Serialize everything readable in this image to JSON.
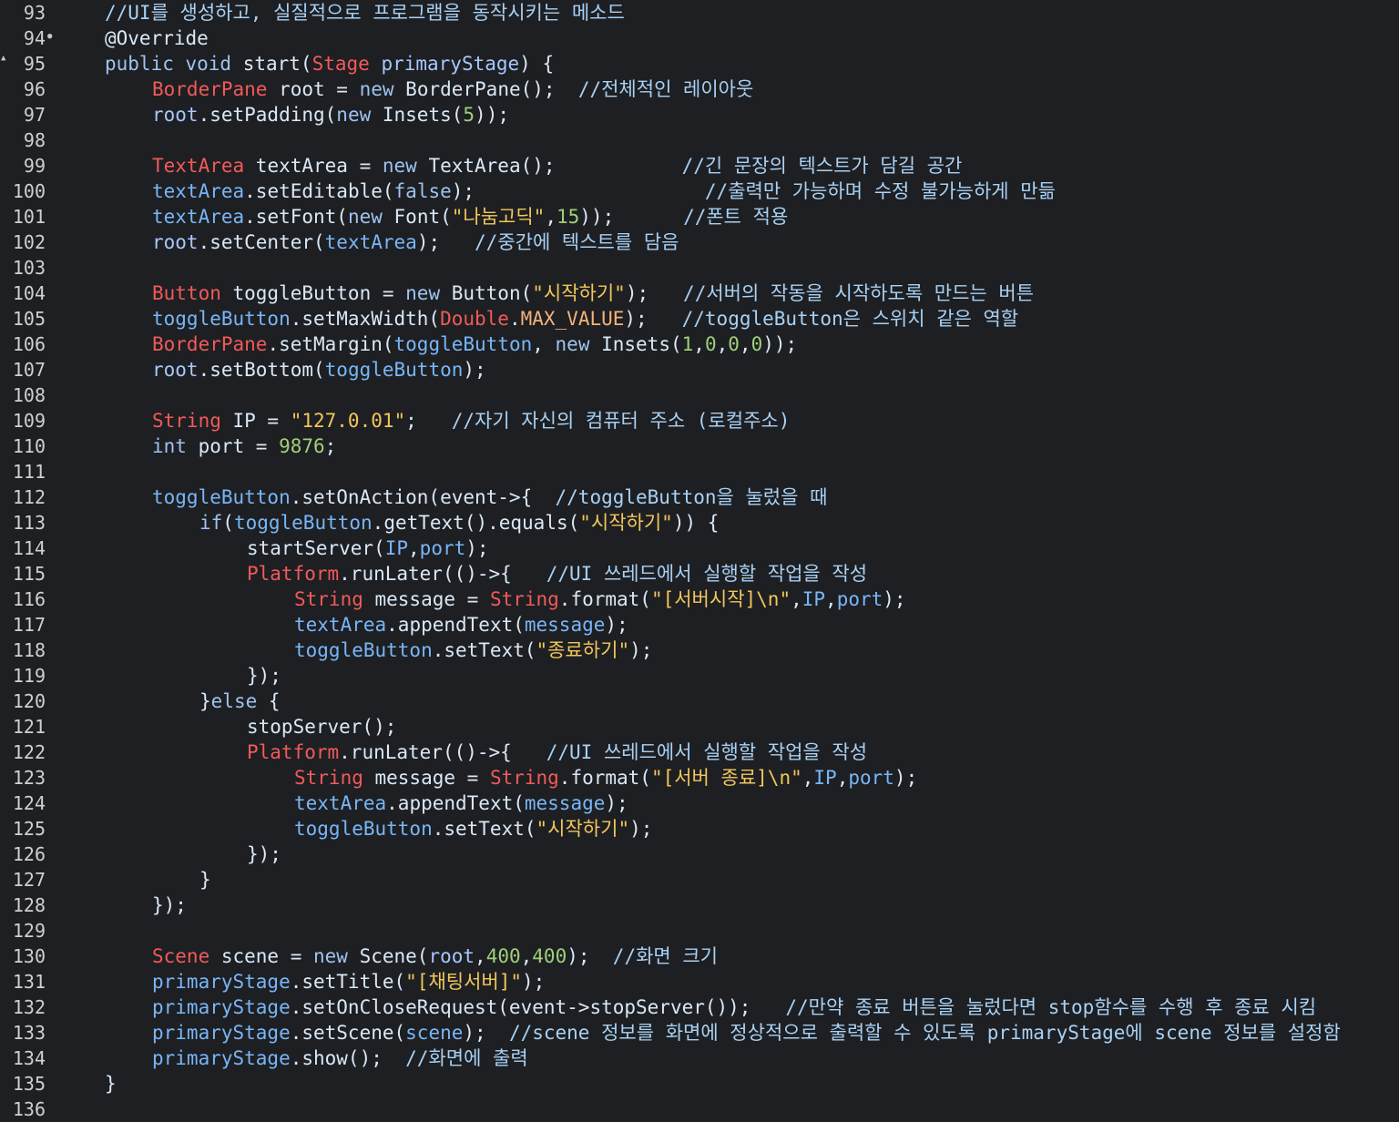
{
  "colors": {
    "background": "#1e1f22",
    "default_text": "#d9e8f7",
    "comment": "#a8d1f5",
    "keyword": "#9ec3f0",
    "type": "#f05a5a",
    "variable": "#a7c7ff",
    "field": "#78b6f8",
    "string": "#f1c75b",
    "number": "#9fd07a",
    "constant": "#f3b27a",
    "line_number": "#d0d0d0"
  },
  "editor": {
    "lines": [
      {
        "num": "93",
        "marker": "",
        "indent": 0,
        "tokens": [
          {
            "t": "//UI를 생성하고, 실질적으로 프로그램을 동작시키는 메소드",
            "k": "comment"
          }
        ]
      },
      {
        "num": "94",
        "marker": "●",
        "indent": 0,
        "tokens": [
          {
            "t": "@Override",
            "k": "annotation"
          }
        ]
      },
      {
        "num": "95",
        "marker": "▲",
        "indent": 0,
        "tokens": [
          {
            "t": "public void ",
            "k": "keyword"
          },
          {
            "t": "start(",
            "k": "default"
          },
          {
            "t": "Stage",
            "k": "type"
          },
          {
            "t": " primaryStage",
            "k": "var"
          },
          {
            "t": ") {",
            "k": "default"
          }
        ]
      },
      {
        "num": "96",
        "marker": "",
        "indent": 1,
        "tokens": [
          {
            "t": "BorderPane",
            "k": "type"
          },
          {
            "t": " root = ",
            "k": "default"
          },
          {
            "t": "new ",
            "k": "keyword"
          },
          {
            "t": "BorderPane();  ",
            "k": "default"
          },
          {
            "t": "//전체적인 레이아웃",
            "k": "comment"
          }
        ]
      },
      {
        "num": "97",
        "marker": "",
        "indent": 1,
        "tokens": [
          {
            "t": "root",
            "k": "var"
          },
          {
            "t": ".setPadding(",
            "k": "default"
          },
          {
            "t": "new ",
            "k": "keyword"
          },
          {
            "t": "Insets(",
            "k": "default"
          },
          {
            "t": "5",
            "k": "number"
          },
          {
            "t": "));",
            "k": "default"
          }
        ]
      },
      {
        "num": "98",
        "marker": "",
        "indent": 0,
        "tokens": []
      },
      {
        "num": "99",
        "marker": "",
        "indent": 1,
        "tokens": [
          {
            "t": "TextArea",
            "k": "type"
          },
          {
            "t": " textArea = ",
            "k": "default"
          },
          {
            "t": "new ",
            "k": "keyword"
          },
          {
            "t": "TextArea();           ",
            "k": "default"
          },
          {
            "t": "//긴 문장의 텍스트가 담길 공간",
            "k": "comment"
          }
        ]
      },
      {
        "num": "100",
        "marker": "",
        "indent": 1,
        "tokens": [
          {
            "t": "textArea",
            "k": "field"
          },
          {
            "t": ".setEditable(",
            "k": "default"
          },
          {
            "t": "false",
            "k": "keyword"
          },
          {
            "t": ");                    ",
            "k": "default"
          },
          {
            "t": "//출력만 가능하며 수정 불가능하게 만듦",
            "k": "comment"
          }
        ]
      },
      {
        "num": "101",
        "marker": "",
        "indent": 1,
        "tokens": [
          {
            "t": "textArea",
            "k": "field"
          },
          {
            "t": ".setFont(",
            "k": "default"
          },
          {
            "t": "new ",
            "k": "keyword"
          },
          {
            "t": "Font(",
            "k": "default"
          },
          {
            "t": "\"나눔고딕\"",
            "k": "string"
          },
          {
            "t": ",",
            "k": "default"
          },
          {
            "t": "15",
            "k": "number"
          },
          {
            "t": "));      ",
            "k": "default"
          },
          {
            "t": "//폰트 적용",
            "k": "comment"
          }
        ]
      },
      {
        "num": "102",
        "marker": "",
        "indent": 1,
        "tokens": [
          {
            "t": "root",
            "k": "var"
          },
          {
            "t": ".setCenter(",
            "k": "default"
          },
          {
            "t": "textArea",
            "k": "field"
          },
          {
            "t": ");   ",
            "k": "default"
          },
          {
            "t": "//중간에 텍스트를 담음",
            "k": "comment"
          }
        ]
      },
      {
        "num": "103",
        "marker": "",
        "indent": 0,
        "tokens": []
      },
      {
        "num": "104",
        "marker": "",
        "indent": 1,
        "tokens": [
          {
            "t": "Button",
            "k": "type"
          },
          {
            "t": " toggleButton = ",
            "k": "default"
          },
          {
            "t": "new ",
            "k": "keyword"
          },
          {
            "t": "Button(",
            "k": "default"
          },
          {
            "t": "\"시작하기\"",
            "k": "string"
          },
          {
            "t": ");   ",
            "k": "default"
          },
          {
            "t": "//서버의 작동을 시작하도록 만드는 버튼",
            "k": "comment"
          }
        ]
      },
      {
        "num": "105",
        "marker": "",
        "indent": 1,
        "tokens": [
          {
            "t": "toggleButton",
            "k": "field"
          },
          {
            "t": ".setMaxWidth(",
            "k": "default"
          },
          {
            "t": "Double",
            "k": "type"
          },
          {
            "t": ".",
            "k": "default"
          },
          {
            "t": "MAX_VALUE",
            "k": "const"
          },
          {
            "t": ");   ",
            "k": "default"
          },
          {
            "t": "//toggleButton은 스위치 같은 역할",
            "k": "comment"
          }
        ]
      },
      {
        "num": "106",
        "marker": "",
        "indent": 1,
        "tokens": [
          {
            "t": "BorderPane",
            "k": "type"
          },
          {
            "t": ".setMargin(",
            "k": "default"
          },
          {
            "t": "toggleButton",
            "k": "field"
          },
          {
            "t": ", ",
            "k": "default"
          },
          {
            "t": "new ",
            "k": "keyword"
          },
          {
            "t": "Insets(",
            "k": "default"
          },
          {
            "t": "1",
            "k": "number"
          },
          {
            "t": ",",
            "k": "default"
          },
          {
            "t": "0",
            "k": "number"
          },
          {
            "t": ",",
            "k": "default"
          },
          {
            "t": "0",
            "k": "number"
          },
          {
            "t": ",",
            "k": "default"
          },
          {
            "t": "0",
            "k": "number"
          },
          {
            "t": "));",
            "k": "default"
          }
        ]
      },
      {
        "num": "107",
        "marker": "",
        "indent": 1,
        "tokens": [
          {
            "t": "root",
            "k": "var"
          },
          {
            "t": ".setBottom(",
            "k": "default"
          },
          {
            "t": "toggleButton",
            "k": "field"
          },
          {
            "t": ");",
            "k": "default"
          }
        ]
      },
      {
        "num": "108",
        "marker": "",
        "indent": 0,
        "tokens": []
      },
      {
        "num": "109",
        "marker": "",
        "indent": 1,
        "tokens": [
          {
            "t": "String",
            "k": "type"
          },
          {
            "t": " IP = ",
            "k": "default"
          },
          {
            "t": "\"127.0.01\"",
            "k": "string"
          },
          {
            "t": ";   ",
            "k": "default"
          },
          {
            "t": "//자기 자신의 컴퓨터 주소 (로컬주소)",
            "k": "comment"
          }
        ]
      },
      {
        "num": "110",
        "marker": "",
        "indent": 1,
        "tokens": [
          {
            "t": "int",
            "k": "keyword"
          },
          {
            "t": " port = ",
            "k": "default"
          },
          {
            "t": "9876",
            "k": "number"
          },
          {
            "t": ";",
            "k": "default"
          }
        ]
      },
      {
        "num": "111",
        "marker": "",
        "indent": 0,
        "tokens": []
      },
      {
        "num": "112",
        "marker": "",
        "indent": 1,
        "tokens": [
          {
            "t": "toggleButton",
            "k": "field"
          },
          {
            "t": ".setOnAction(event->{  ",
            "k": "default"
          },
          {
            "t": "//toggleButton을 눌렀을 때",
            "k": "comment"
          }
        ]
      },
      {
        "num": "113",
        "marker": "",
        "indent": 2,
        "tokens": [
          {
            "t": "if",
            "k": "keyword"
          },
          {
            "t": "(",
            "k": "default"
          },
          {
            "t": "toggleButton",
            "k": "field"
          },
          {
            "t": ".getText().equals(",
            "k": "default"
          },
          {
            "t": "\"시작하기\"",
            "k": "string"
          },
          {
            "t": ")) {",
            "k": "default"
          }
        ]
      },
      {
        "num": "114",
        "marker": "",
        "indent": 3,
        "tokens": [
          {
            "t": "startServer(",
            "k": "default"
          },
          {
            "t": "IP",
            "k": "field"
          },
          {
            "t": ",",
            "k": "default"
          },
          {
            "t": "port",
            "k": "field"
          },
          {
            "t": ");",
            "k": "default"
          }
        ]
      },
      {
        "num": "115",
        "marker": "",
        "indent": 3,
        "tokens": [
          {
            "t": "Platform",
            "k": "type"
          },
          {
            "t": ".runLater(()->{   ",
            "k": "default"
          },
          {
            "t": "//UI 쓰레드에서 실행할 작업을 작성",
            "k": "comment"
          }
        ]
      },
      {
        "num": "116",
        "marker": "",
        "indent": 4,
        "tokens": [
          {
            "t": "String",
            "k": "type"
          },
          {
            "t": " message = ",
            "k": "default"
          },
          {
            "t": "String",
            "k": "type"
          },
          {
            "t": ".format(",
            "k": "default"
          },
          {
            "t": "\"[서버시작]\\n\"",
            "k": "string"
          },
          {
            "t": ",",
            "k": "default"
          },
          {
            "t": "IP",
            "k": "field"
          },
          {
            "t": ",",
            "k": "default"
          },
          {
            "t": "port",
            "k": "field"
          },
          {
            "t": ");",
            "k": "default"
          }
        ]
      },
      {
        "num": "117",
        "marker": "",
        "indent": 4,
        "tokens": [
          {
            "t": "textArea",
            "k": "field"
          },
          {
            "t": ".appendText(",
            "k": "default"
          },
          {
            "t": "message",
            "k": "field"
          },
          {
            "t": ");",
            "k": "default"
          }
        ]
      },
      {
        "num": "118",
        "marker": "",
        "indent": 4,
        "tokens": [
          {
            "t": "toggleButton",
            "k": "field"
          },
          {
            "t": ".setText(",
            "k": "default"
          },
          {
            "t": "\"종료하기\"",
            "k": "string"
          },
          {
            "t": ");",
            "k": "default"
          }
        ]
      },
      {
        "num": "119",
        "marker": "",
        "indent": 3,
        "tokens": [
          {
            "t": "});",
            "k": "default"
          }
        ]
      },
      {
        "num": "120",
        "marker": "",
        "indent": 2,
        "tokens": [
          {
            "t": "}",
            "k": "default"
          },
          {
            "t": "else",
            "k": "keyword"
          },
          {
            "t": " {",
            "k": "default"
          }
        ]
      },
      {
        "num": "121",
        "marker": "",
        "indent": 3,
        "tokens": [
          {
            "t": "stopServer();",
            "k": "default"
          }
        ]
      },
      {
        "num": "122",
        "marker": "",
        "indent": 3,
        "tokens": [
          {
            "t": "Platform",
            "k": "type"
          },
          {
            "t": ".runLater(()->{   ",
            "k": "default"
          },
          {
            "t": "//UI 쓰레드에서 실행할 작업을 작성",
            "k": "comment"
          }
        ]
      },
      {
        "num": "123",
        "marker": "",
        "indent": 4,
        "tokens": [
          {
            "t": "String",
            "k": "type"
          },
          {
            "t": " message = ",
            "k": "default"
          },
          {
            "t": "String",
            "k": "type"
          },
          {
            "t": ".format(",
            "k": "default"
          },
          {
            "t": "\"[서버 종료]\\n\"",
            "k": "string"
          },
          {
            "t": ",",
            "k": "default"
          },
          {
            "t": "IP",
            "k": "field"
          },
          {
            "t": ",",
            "k": "default"
          },
          {
            "t": "port",
            "k": "field"
          },
          {
            "t": ");",
            "k": "default"
          }
        ]
      },
      {
        "num": "124",
        "marker": "",
        "indent": 4,
        "tokens": [
          {
            "t": "textArea",
            "k": "field"
          },
          {
            "t": ".appendText(",
            "k": "default"
          },
          {
            "t": "message",
            "k": "field"
          },
          {
            "t": ");",
            "k": "default"
          }
        ]
      },
      {
        "num": "125",
        "marker": "",
        "indent": 4,
        "tokens": [
          {
            "t": "toggleButton",
            "k": "field"
          },
          {
            "t": ".setText(",
            "k": "default"
          },
          {
            "t": "\"시작하기\"",
            "k": "string"
          },
          {
            "t": ");",
            "k": "default"
          }
        ]
      },
      {
        "num": "126",
        "marker": "",
        "indent": 3,
        "tokens": [
          {
            "t": "});",
            "k": "default"
          }
        ]
      },
      {
        "num": "127",
        "marker": "",
        "indent": 2,
        "tokens": [
          {
            "t": "}",
            "k": "default"
          }
        ]
      },
      {
        "num": "128",
        "marker": "",
        "indent": 1,
        "tokens": [
          {
            "t": "});",
            "k": "default"
          }
        ]
      },
      {
        "num": "129",
        "marker": "",
        "indent": 0,
        "tokens": []
      },
      {
        "num": "130",
        "marker": "",
        "indent": 1,
        "tokens": [
          {
            "t": "Scene",
            "k": "type"
          },
          {
            "t": " scene = ",
            "k": "default"
          },
          {
            "t": "new ",
            "k": "keyword"
          },
          {
            "t": "Scene(",
            "k": "default"
          },
          {
            "t": "root",
            "k": "var"
          },
          {
            "t": ",",
            "k": "default"
          },
          {
            "t": "400",
            "k": "number"
          },
          {
            "t": ",",
            "k": "default"
          },
          {
            "t": "400",
            "k": "number"
          },
          {
            "t": ");  ",
            "k": "default"
          },
          {
            "t": "//화면 크기",
            "k": "comment"
          }
        ]
      },
      {
        "num": "131",
        "marker": "",
        "indent": 1,
        "tokens": [
          {
            "t": "primaryStage",
            "k": "field"
          },
          {
            "t": ".setTitle(",
            "k": "default"
          },
          {
            "t": "\"[채팅서버]\"",
            "k": "string"
          },
          {
            "t": ");",
            "k": "default"
          }
        ]
      },
      {
        "num": "132",
        "marker": "",
        "indent": 1,
        "tokens": [
          {
            "t": "primaryStage",
            "k": "field"
          },
          {
            "t": ".setOnCloseRequest(event->stopServer());   ",
            "k": "default"
          },
          {
            "t": "//만약 종료 버튼을 눌렀다면 stop함수를 수행 후 종료 시킴",
            "k": "comment"
          }
        ]
      },
      {
        "num": "133",
        "marker": "",
        "indent": 1,
        "tokens": [
          {
            "t": "primaryStage",
            "k": "field"
          },
          {
            "t": ".setScene(",
            "k": "default"
          },
          {
            "t": "scene",
            "k": "field"
          },
          {
            "t": ");  ",
            "k": "default"
          },
          {
            "t": "//scene 정보를 화면에 정상적으로 출력할 수 있도록 primaryStage에 scene 정보를 설정함",
            "k": "comment"
          }
        ]
      },
      {
        "num": "134",
        "marker": "",
        "indent": 1,
        "tokens": [
          {
            "t": "primaryStage",
            "k": "field"
          },
          {
            "t": ".show();  ",
            "k": "default"
          },
          {
            "t": "//화면에 출력",
            "k": "comment"
          }
        ]
      },
      {
        "num": "135",
        "marker": "",
        "indent": 0,
        "tokens": [
          {
            "t": "}",
            "k": "default"
          }
        ]
      },
      {
        "num": "136",
        "marker": "",
        "indent": 0,
        "tokens": []
      }
    ]
  }
}
